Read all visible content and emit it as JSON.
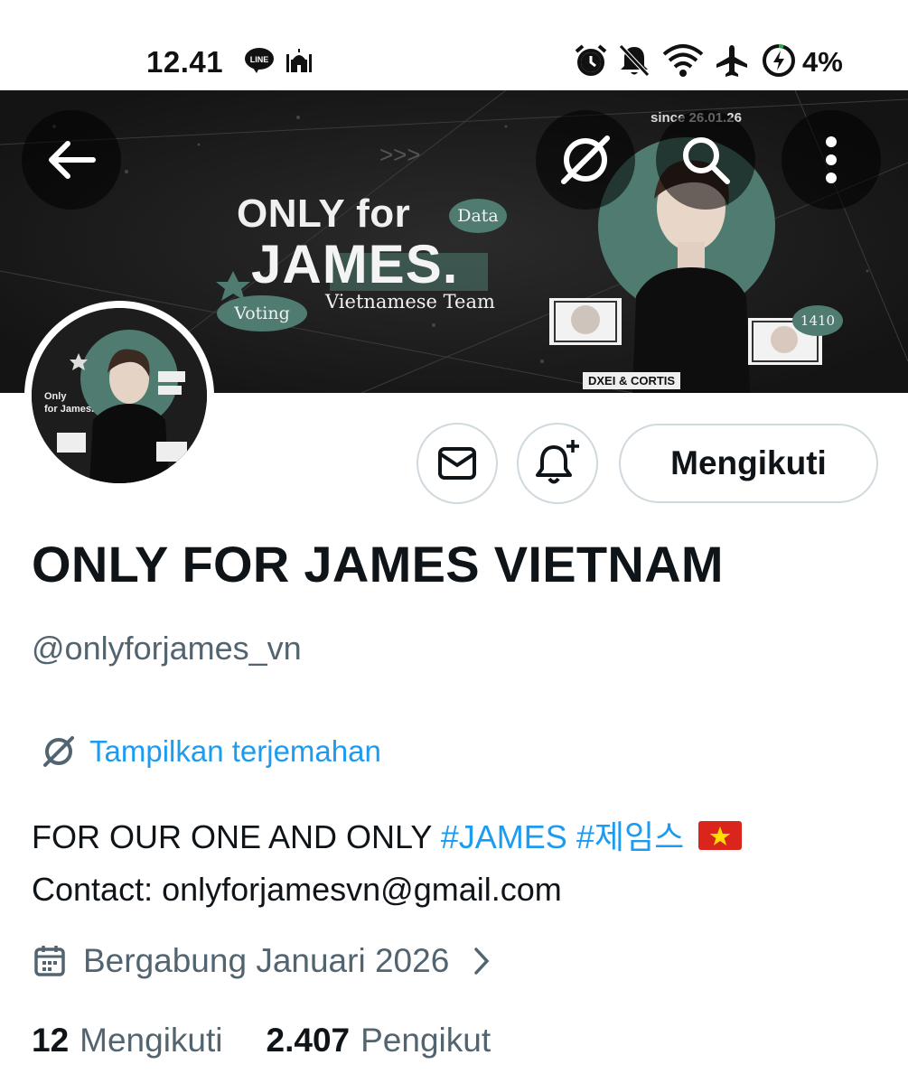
{
  "status_bar": {
    "time": "12.41",
    "line_badge": "LINE",
    "battery": "4%",
    "icons": [
      "line-icon",
      "mosque-icon",
      "alarm-icon",
      "bell-off-icon",
      "wifi-icon",
      "airplane-icon",
      "battery-charging-icon"
    ]
  },
  "banner": {
    "since": "since 26.01.26",
    "title_line1": "ONLY for",
    "title_line2": "JAMES.",
    "pill_data": "Data",
    "pill_voting": "Voting",
    "team": "Vietnamese Team",
    "badge": "1410",
    "brand_text": "DXEI & CORTIS"
  },
  "avatar": {
    "caption_line1": "Only",
    "caption_line2": "for James."
  },
  "actions": {
    "follow_label": "Mengikuti"
  },
  "profile": {
    "display_name": "ONLY FOR JAMES VIETNAM",
    "handle": "@onlyforjames_vn",
    "translate_label": "Tampilkan terjemahan",
    "bio_text": "FOR OUR ONE AND ONLY ",
    "bio_hashtag_1": "#JAMES",
    "bio_hashtag_2": "#제임스",
    "bio_line2": "Contact: onlyforjamesvn@gmail.com",
    "joined": "Bergabung Januari 2026",
    "following_count": "12",
    "following_label": "Mengikuti",
    "followers_count": "2.407",
    "followers_label": "Pengikut"
  },
  "colors": {
    "link": "#1d9bf0",
    "secondary": "#536471",
    "banner_accent": "#4f7b70",
    "banner_bg": "#1c1c1c"
  }
}
